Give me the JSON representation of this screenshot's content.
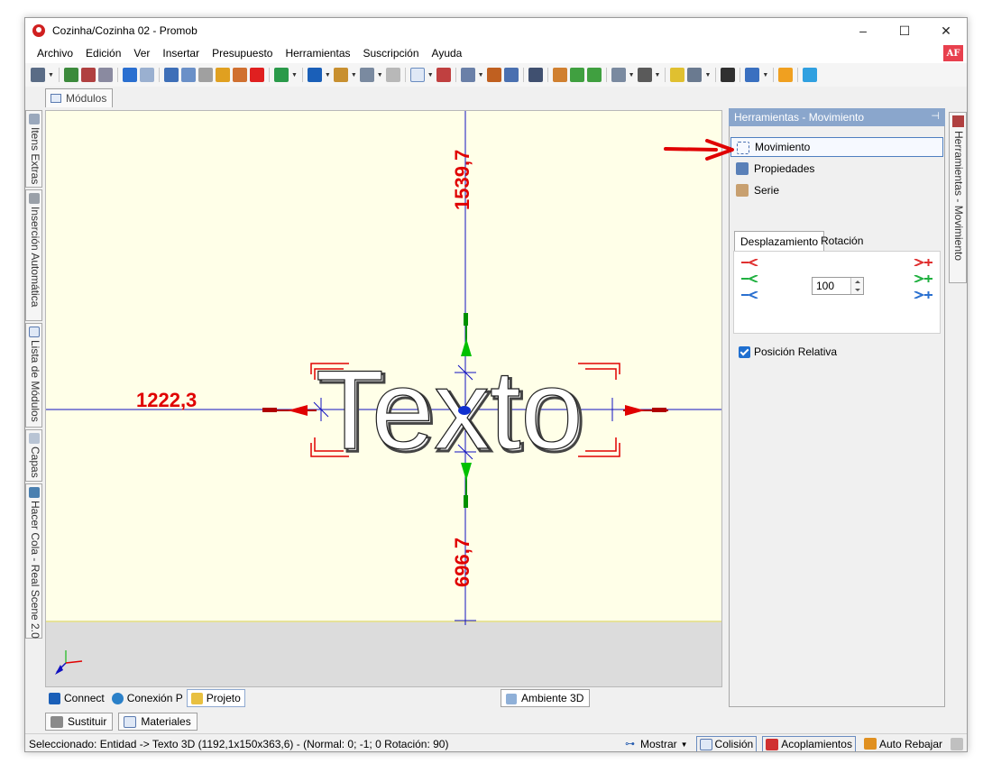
{
  "window": {
    "title": "Cozinha/Cozinha 02 - Promob",
    "controls": {
      "minimize": "–",
      "maximize": "☐",
      "close": "✕"
    }
  },
  "menu": {
    "items": [
      "Archivo",
      "Edición",
      "Ver",
      "Insertar",
      "Presupuesto",
      "Herramientas",
      "Suscripción",
      "Ayuda"
    ],
    "badge": "AF"
  },
  "doc_tab": {
    "label": "Módulos"
  },
  "left_dock": {
    "tabs": [
      {
        "label": "Itens Extras",
        "icon": "paperclip-icon"
      },
      {
        "label": "Inserción Automática",
        "icon": "gears-icon"
      },
      {
        "label": "Lista de Módulos",
        "icon": "list-icon"
      },
      {
        "label": "Capas",
        "icon": "layers-icon"
      },
      {
        "label": "Hacer Cola - Real Scene 2.0",
        "icon": "render-icon"
      }
    ]
  },
  "viewport": {
    "text_object": "Texto",
    "dimensions": {
      "top": "1539,7",
      "left": "1222,3",
      "bottom": "696,7"
    },
    "colors": {
      "background": "#ffffe8",
      "floor": "#dcdcdc",
      "axis": "#1010c0",
      "dimension": "#e00000"
    }
  },
  "bottom_tabs": {
    "items": [
      "Connect",
      "Conexión P",
      "Projeto"
    ],
    "ambient": "Ambiente 3D"
  },
  "sub_tabs": [
    "Sustituir",
    "Materiales"
  ],
  "right_panel": {
    "header": "Herramientas - Movimiento",
    "pin": "⊣",
    "items": [
      "Movimiento",
      "Propiedades",
      "Serie"
    ],
    "tabs": [
      "Desplazamiento",
      "Rotación"
    ],
    "step_value": "100",
    "relative_label": "Posición Relativa"
  },
  "right_vtab": {
    "label": "Herramientas - Movimiento"
  },
  "status": {
    "text": "Seleccionado: Entidad -> Texto 3D (1192,1x150x363,6) - (Normal: 0; -1; 0 Rotación: 90)",
    "buttons": [
      "Mostrar",
      "Colisión",
      "Acoplamientos",
      "Auto Rebajar"
    ]
  }
}
